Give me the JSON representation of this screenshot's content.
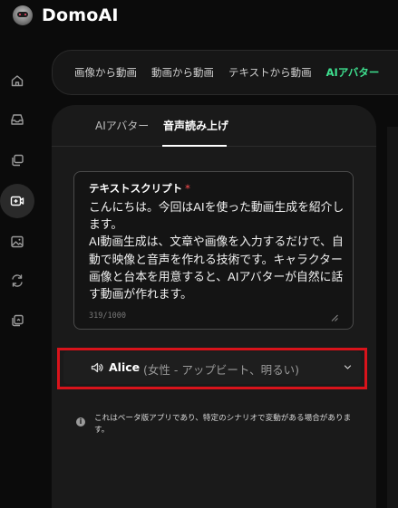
{
  "app": {
    "name": "DomoAI"
  },
  "sidebar": {
    "items": [
      {
        "icon": "home-icon"
      },
      {
        "icon": "inbox-icon"
      },
      {
        "icon": "layers-icon"
      },
      {
        "icon": "avatar-video-icon",
        "active": true
      },
      {
        "icon": "image-icon"
      },
      {
        "icon": "swap-icon"
      },
      {
        "icon": "gallery-icon"
      }
    ]
  },
  "top_tabs": [
    {
      "label": "画像から動画",
      "active": false
    },
    {
      "label": "動画から動画",
      "active": false
    },
    {
      "label": "テキストから動画",
      "active": false
    },
    {
      "label": "AIアバター",
      "active": true
    }
  ],
  "subtabs": [
    {
      "label": "AIアバター",
      "active": false
    },
    {
      "label": "音声読み上げ",
      "active": true
    }
  ],
  "script": {
    "label": "テキストスクリプト",
    "required_mark": "*",
    "text": "こんにちは。今回はAIを使った動画生成を紹介します。\nAI動画生成は、文章や画像を入力するだけで、自動で映像と音声を作れる技術です。キャラクター画像と台本を用意すると、AIアバターが自然に話す動画が作れます。",
    "char_count": "319/1000"
  },
  "voice": {
    "name": "Alice",
    "description": "(女性 - アップビート、明るい)"
  },
  "notice": {
    "text": "これはベータ版アプリであり、特定のシナリオで変動がある場合があります。"
  },
  "colors": {
    "background": "#0b0b0b",
    "panel": "#1a1a1a",
    "accent_green": "#3ee08f",
    "highlight_red": "#d8131b",
    "required_red": "#ff4d4f"
  }
}
